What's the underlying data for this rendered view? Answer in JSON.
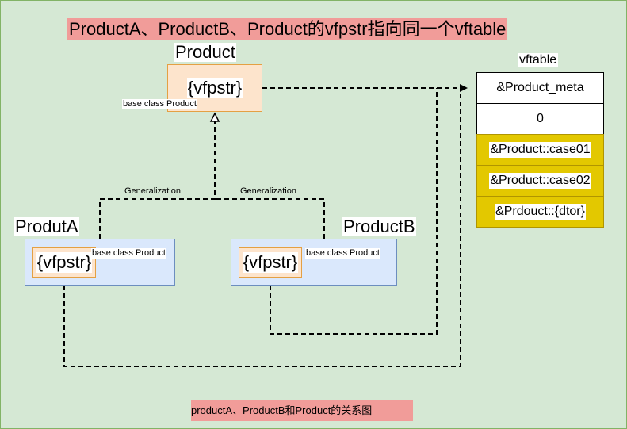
{
  "title": "ProductA、ProductB、Product的vfpstr指向同一个vftable",
  "caption": "productA、ProductB和Product的关系图",
  "classes": {
    "product": {
      "name": "Product",
      "vfptr": "{vfpstr}",
      "base_label": "base class Product"
    },
    "product_a": {
      "name": "ProdutA",
      "vfptr": "{vfpstr}",
      "base_label": "base class Product"
    },
    "product_b": {
      "name": "ProductB",
      "vfptr": "{vfpstr}",
      "base_label": "base class Product"
    }
  },
  "edges": {
    "gen_left": "Generalization",
    "gen_right": "Generalization"
  },
  "vftable": {
    "title": "vftable",
    "rows": [
      "&Product_meta",
      "0",
      "&Product::case01",
      "&Product::case02",
      "&Prdouct::{dtor}"
    ]
  },
  "colors": {
    "background": "#d5e8d4",
    "highlight": "#f19c99",
    "orange_fill": "#fde4cc",
    "orange_stroke": "#e4a043",
    "blue_fill": "#dae8fc",
    "blue_stroke": "#6c8ebf",
    "gold": "#e3c800"
  }
}
